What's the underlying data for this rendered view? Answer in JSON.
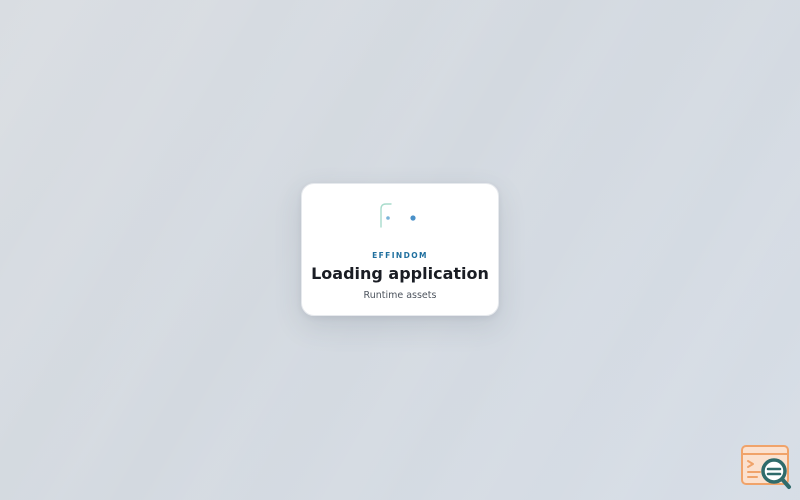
{
  "loader": {
    "brand": "EFFINDOM",
    "title": "Loading application",
    "subtitle": "Runtime assets"
  },
  "icons": {
    "spinner": "loading-spinner-icon",
    "corner_logo": "terminal-search-logo-icon"
  },
  "colors": {
    "accent": "#1f6f9e",
    "spinner_arc": "#9fd6c6",
    "spinner_dot": "#4a90c8",
    "logo_orange": "#f0a36a",
    "logo_teal": "#2f6b6b"
  }
}
